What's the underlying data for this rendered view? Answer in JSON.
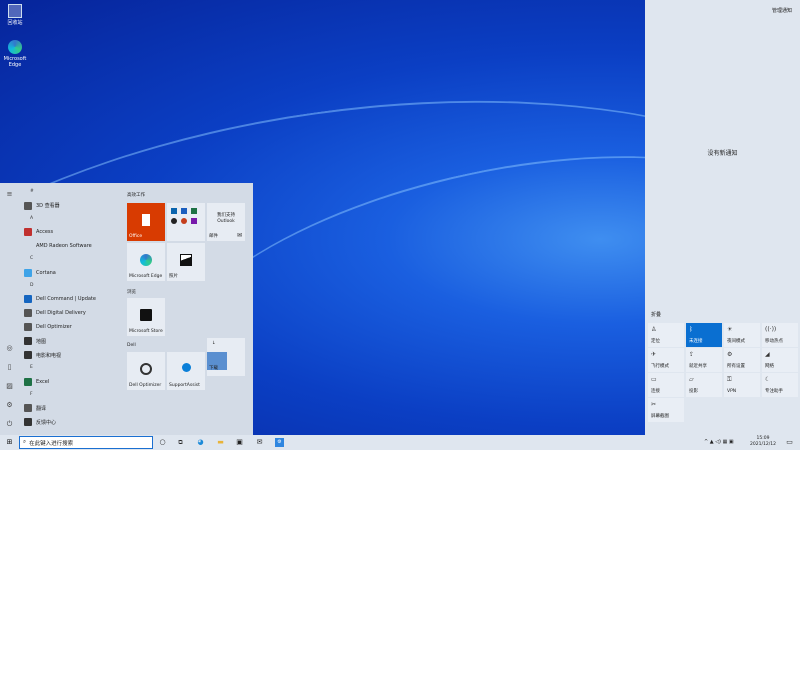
{
  "desktop": {
    "icons": [
      {
        "label": "回收站"
      },
      {
        "label": "Microsoft Edge"
      }
    ]
  },
  "start": {
    "apps": [
      {
        "type": "header",
        "label": "#"
      },
      {
        "type": "app",
        "label": "3D 查看器",
        "color": "#555"
      },
      {
        "type": "header",
        "label": "A"
      },
      {
        "type": "app",
        "label": "Access",
        "color": "#c0302f"
      },
      {
        "type": "app",
        "label": "AMD Radeon Software",
        "color": ""
      },
      {
        "type": "header",
        "label": "C"
      },
      {
        "type": "app",
        "label": "Cortana",
        "color": "#3ea3e8"
      },
      {
        "type": "header",
        "label": "D"
      },
      {
        "type": "app",
        "label": "Dell Command | Update",
        "color": "#1565c0"
      },
      {
        "type": "app",
        "label": "Dell Digital Delivery",
        "color": "#555"
      },
      {
        "type": "app",
        "label": "Dell Optimizer",
        "color": "#555"
      },
      {
        "type": "app",
        "label": "地图",
        "color": "#333"
      },
      {
        "type": "app",
        "label": "电影和电视",
        "color": "#333"
      },
      {
        "type": "header",
        "label": "E"
      },
      {
        "type": "app",
        "label": "Excel",
        "color": "#1e7145"
      },
      {
        "type": "header",
        "label": "F"
      },
      {
        "type": "app",
        "label": "翻译",
        "color": "#555"
      },
      {
        "type": "app",
        "label": "反馈中心",
        "color": "#333"
      }
    ],
    "groups": [
      "高效工作",
      "浏览",
      "Dell"
    ],
    "tiles": {
      "office": "Office",
      "outlook_line1": "我们支持",
      "outlook_line2": "Outlook",
      "mail": "邮件",
      "edge": "Microsoft Edge",
      "photos": "照片",
      "store": "Microsoft Store",
      "dell_optimizer": "Dell Optimizer",
      "supportassist": "SupportAssist",
      "download_arrow": "↓",
      "download_label": "下载"
    }
  },
  "action_center": {
    "manage": "管理通知",
    "no_notifications": "没有新通知",
    "collapse": "折叠",
    "quick_actions": [
      {
        "label": "定位",
        "icon": "♙",
        "on": false
      },
      {
        "label": "未连接",
        "icon": "ᛒ",
        "on": true
      },
      {
        "label": "夜间模式",
        "icon": "☀",
        "on": false
      },
      {
        "label": "移动热点",
        "icon": "((·))",
        "on": false
      },
      {
        "label": "飞行模式",
        "icon": "✈",
        "on": false
      },
      {
        "label": "就近共享",
        "icon": "⇪",
        "on": false
      },
      {
        "label": "所有设置",
        "icon": "⚙",
        "on": false
      },
      {
        "label": "网络",
        "icon": "◢",
        "on": false
      },
      {
        "label": "连接",
        "icon": "▭",
        "on": false
      },
      {
        "label": "投影",
        "icon": "▱",
        "on": false
      },
      {
        "label": "VPN",
        "icon": "⚿",
        "on": false
      },
      {
        "label": "专注助手",
        "icon": "☾",
        "on": false
      },
      {
        "label": "屏幕截图",
        "icon": "✂",
        "on": false
      }
    ]
  },
  "taskbar": {
    "search_placeholder": "在此键入进行搜索",
    "time": "15:09",
    "date": "2021/12/12",
    "tray": "^ ▲ ◁) ▦ ▣"
  },
  "colors": {
    "office": "#d83b01",
    "accent": "#0a6fd1"
  }
}
